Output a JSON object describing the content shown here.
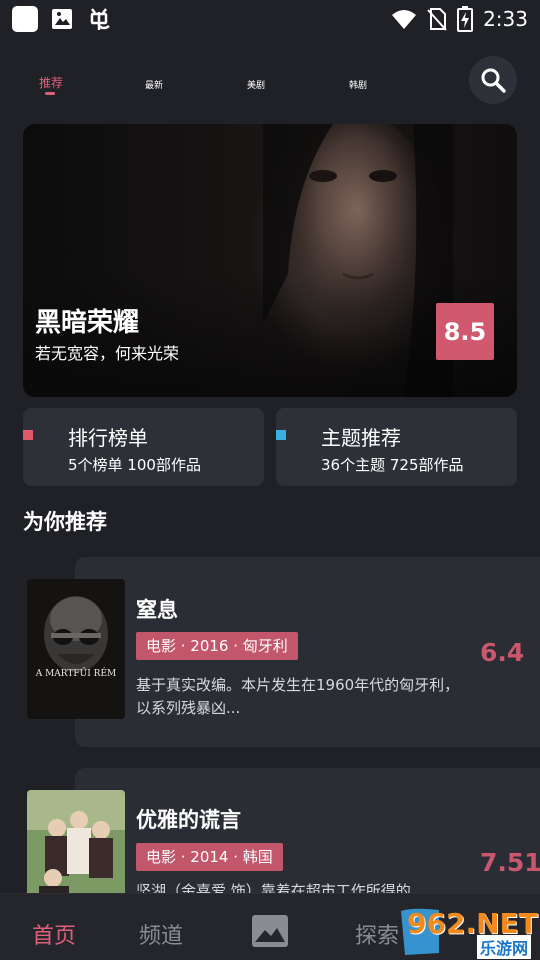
{
  "status_bar": {
    "time": "2:33",
    "left_icons": [
      "app-square-icon",
      "gallery-icon",
      "bug-icon"
    ],
    "right_icons": [
      "wifi-icon",
      "no-sim-icon",
      "battery-charging-icon"
    ]
  },
  "top_nav": {
    "tabs": [
      {
        "label": "推荐",
        "active": true
      },
      {
        "label": "最新",
        "active": false
      },
      {
        "label": "美剧",
        "active": false
      },
      {
        "label": "韩剧",
        "active": false
      }
    ],
    "search_icon": "search-icon"
  },
  "hero": {
    "title": "黑暗荣耀",
    "subtitle": "若无宽容，何来光荣",
    "score": "8.5"
  },
  "categories": [
    {
      "title": "排行榜单",
      "subtitle": "5个榜单  100部作品",
      "color": "#e05a6a"
    },
    {
      "title": "主题推荐",
      "subtitle": "36个主题  725部作品",
      "color": "#3ab0e0"
    }
  ],
  "section": {
    "title": "为你推荐"
  },
  "recommendations": [
    {
      "title": "窒息",
      "tag": "电影 · 2016 · 匈牙利",
      "description": "基于真实改编。本片发生在1960年代的匈牙利，以系列残暴凶...",
      "score": "6.4",
      "poster_text": "A MARTFŰI RÉM"
    },
    {
      "title": "优雅的谎言",
      "tag": "电影 · 2014 · 韩国",
      "description": "坚湖（金喜爱 饰）靠着在超市工作所得的",
      "score": "7.51",
      "poster_text": ""
    }
  ],
  "bottom_nav": {
    "items": [
      {
        "label": "首页",
        "active": true
      },
      {
        "label": "频道",
        "active": false
      },
      {
        "label": "探索",
        "active": false
      }
    ],
    "center_icon": "media-icon"
  },
  "watermark": {
    "text": "962.NET",
    "sub": "乐游网"
  },
  "colors": {
    "accent": "#e0607a",
    "score": "#c9586e",
    "tag_bg": "#c2566a",
    "background": "#1f2126",
    "card": "#2d3037"
  }
}
